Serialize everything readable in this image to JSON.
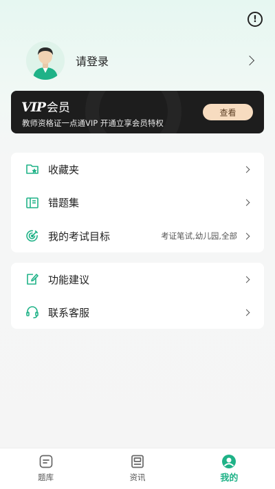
{
  "header": {
    "alert_icon": "exclamation-circle-icon"
  },
  "profile": {
    "login_text": "请登录",
    "avatar_icon": "user-avatar-icon"
  },
  "vip": {
    "logo": "VIP",
    "label": "会员",
    "description": "教师资格证一点通VIP  开通立享会员特权",
    "button": "查看",
    "colors": {
      "background": "#1d1d1d",
      "button": "#f7dcc0"
    }
  },
  "menu_primary": [
    {
      "label": "收藏夹",
      "icon": "folder-star-icon",
      "value": ""
    },
    {
      "label": "错题集",
      "icon": "book-icon",
      "value": ""
    },
    {
      "label": "我的考试目标",
      "icon": "target-icon",
      "value": "考证笔试,幼儿园,全部"
    }
  ],
  "menu_secondary": [
    {
      "label": "功能建议",
      "icon": "edit-document-icon"
    },
    {
      "label": "联系客服",
      "icon": "headset-icon"
    }
  ],
  "tabbar": [
    {
      "label": "题库",
      "icon": "question-bank-icon",
      "active": false
    },
    {
      "label": "资讯",
      "icon": "news-icon",
      "active": false
    },
    {
      "label": "我的",
      "icon": "profile-icon",
      "active": true
    }
  ],
  "accent_color": "#1fb287"
}
